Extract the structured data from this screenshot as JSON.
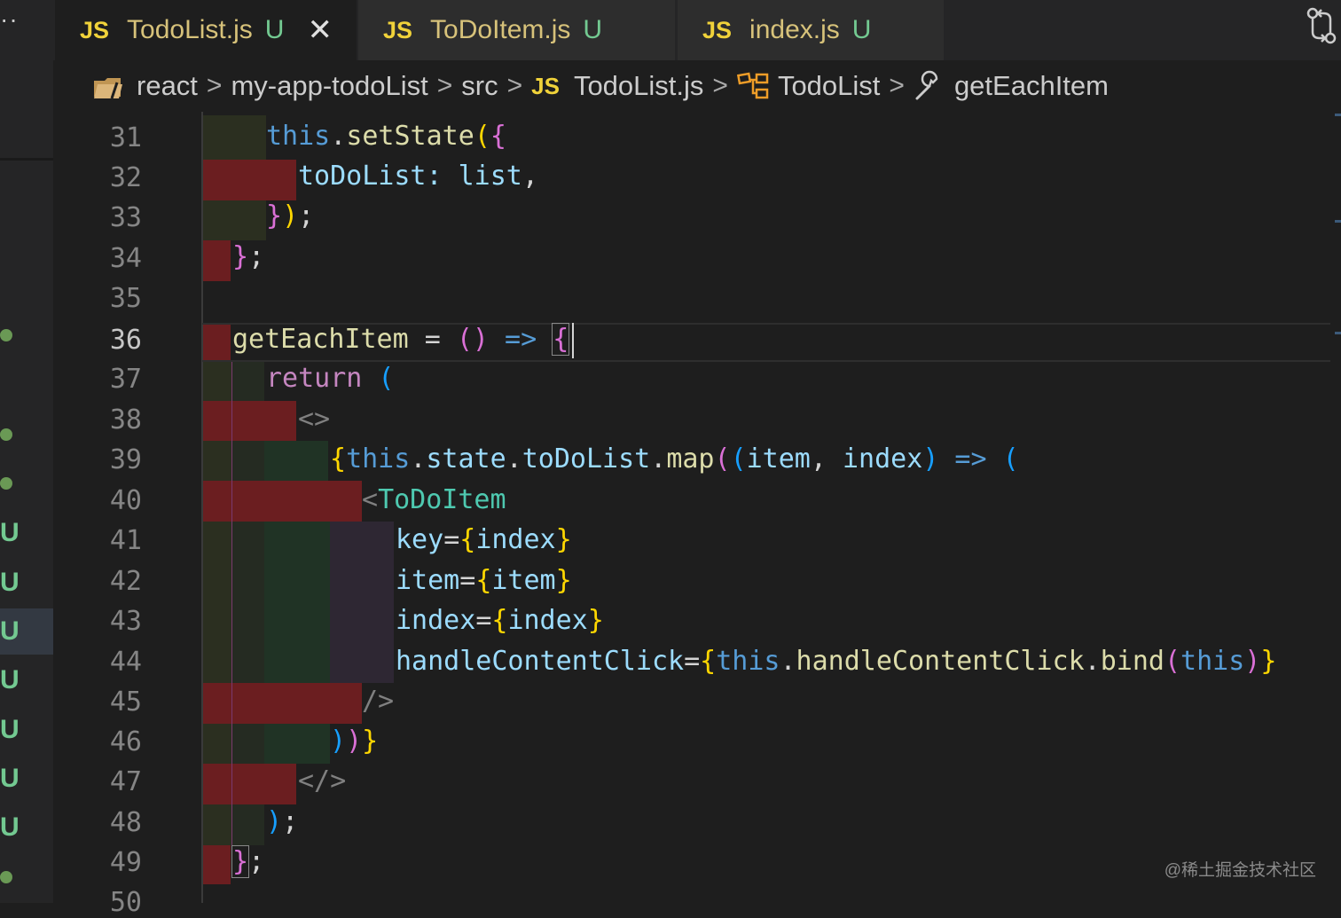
{
  "window": {
    "more_label": "··",
    "tabs": [
      {
        "icon": "JS",
        "name": "TodoList.js",
        "badge": "U",
        "close": "✕"
      },
      {
        "icon": "JS",
        "name": "ToDoItem.js",
        "badge": "U"
      },
      {
        "icon": "JS",
        "name": "index.js",
        "badge": "U"
      }
    ]
  },
  "breadcrumb": {
    "folder1": "react",
    "folder2": "my-app-todoList",
    "folder3": "src",
    "file_icon": "JS",
    "file": "TodoList.js",
    "class": "TodoList",
    "method": "getEachItem",
    "separator": ">"
  },
  "gutter": {
    "badges": [
      "U",
      "U",
      "U",
      "U",
      "U",
      "U",
      "U"
    ]
  },
  "editor": {
    "current_line": 36,
    "line_numbers": [
      "31",
      "32",
      "33",
      "34",
      "35",
      "36",
      "37",
      "38",
      "39",
      "40",
      "41",
      "42",
      "43",
      "44",
      "45",
      "46",
      "47",
      "48",
      "49",
      "50"
    ],
    "lines": {
      "l31": {
        "a": "this",
        "b": ".",
        "c": "setState",
        "d": "(",
        "e": "{"
      },
      "l32": {
        "a": "toDoList",
        "b": ": ",
        "c": "list",
        "d": ","
      },
      "l33": {
        "a": "}",
        "b": ")",
        "c": ";"
      },
      "l34": {
        "a": "}",
        "b": ";"
      },
      "l36": {
        "a": "getEachItem",
        "b": " = ",
        "c": "()",
        "d": " => ",
        "e": "{"
      },
      "l37": {
        "a": "return",
        "b": " ("
      },
      "l38": {
        "a": "<>"
      },
      "l39": {
        "a": "{",
        "b": "this",
        "c": ".",
        "d": "state",
        "e": ".",
        "f": "toDoList",
        "g": ".",
        "h": "map",
        "i": "(",
        "j": "(",
        "k": "item",
        "l": ", ",
        "m": "index",
        "n": ")",
        "o": " => ",
        "p": "("
      },
      "l40": {
        "a": "<",
        "b": "ToDoItem"
      },
      "l41": {
        "a": "key",
        "b": "=",
        "c": "{",
        "d": "index",
        "e": "}"
      },
      "l42": {
        "a": "item",
        "b": "=",
        "c": "{",
        "d": "item",
        "e": "}"
      },
      "l43": {
        "a": "index",
        "b": "=",
        "c": "{",
        "d": "index",
        "e": "}"
      },
      "l44": {
        "a": "handleContentClick",
        "b": "=",
        "c": "{",
        "d": "this",
        "e": ".",
        "f": "handleContentClick",
        "g": ".",
        "h": "bind",
        "i": "(",
        "j": "this",
        "k": ")",
        "l": "}"
      },
      "l45": {
        "a": "/>"
      },
      "l46": {
        "a": ")",
        "b": ")",
        "c": "}"
      },
      "l47": {
        "a": "</>"
      },
      "l48": {
        "a": ")",
        "b": ";"
      },
      "l49": {
        "a": "}",
        "b": ";"
      }
    }
  },
  "watermark": "@稀土掘金技术社区",
  "colors": {
    "accent_js": "#f0d23a",
    "untracked_badge": "#73c991",
    "indent_error": "#6b1e20"
  },
  "icons": [
    "folder-icon",
    "class-icon",
    "method-icon",
    "compare-changes-icon",
    "close-icon"
  ]
}
